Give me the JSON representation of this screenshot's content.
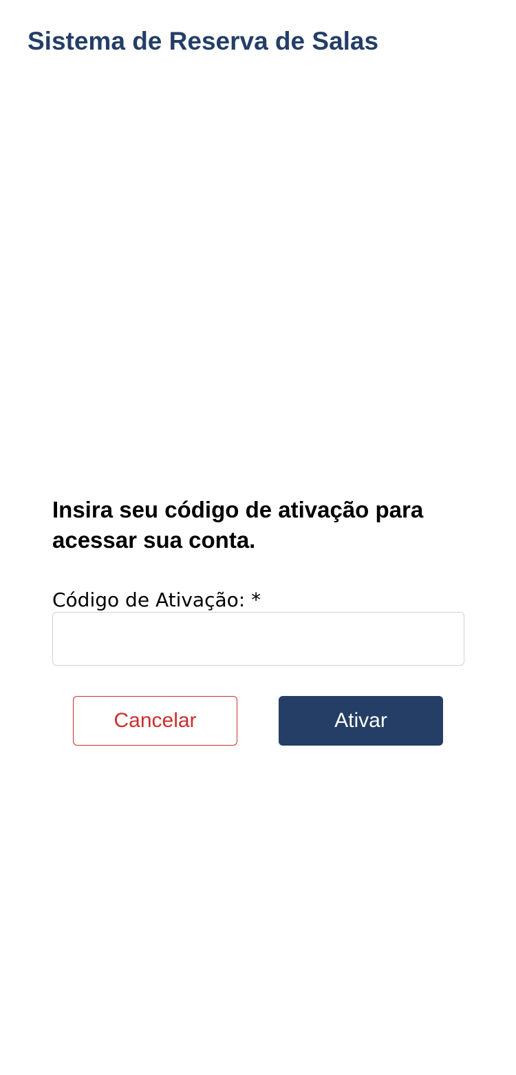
{
  "header": {
    "title": "Sistema de Reserva de Salas"
  },
  "activation_form": {
    "heading": "Insira seu código de ativação para acessar sua conta.",
    "code_label": "Código de Ativação: *",
    "code_value": "",
    "code_placeholder": "",
    "cancel_label": "Cancelar",
    "submit_label": "Ativar"
  },
  "colors": {
    "brand": "#243e66",
    "danger": "#cc2e2e",
    "input_border": "#cfd1d4"
  }
}
